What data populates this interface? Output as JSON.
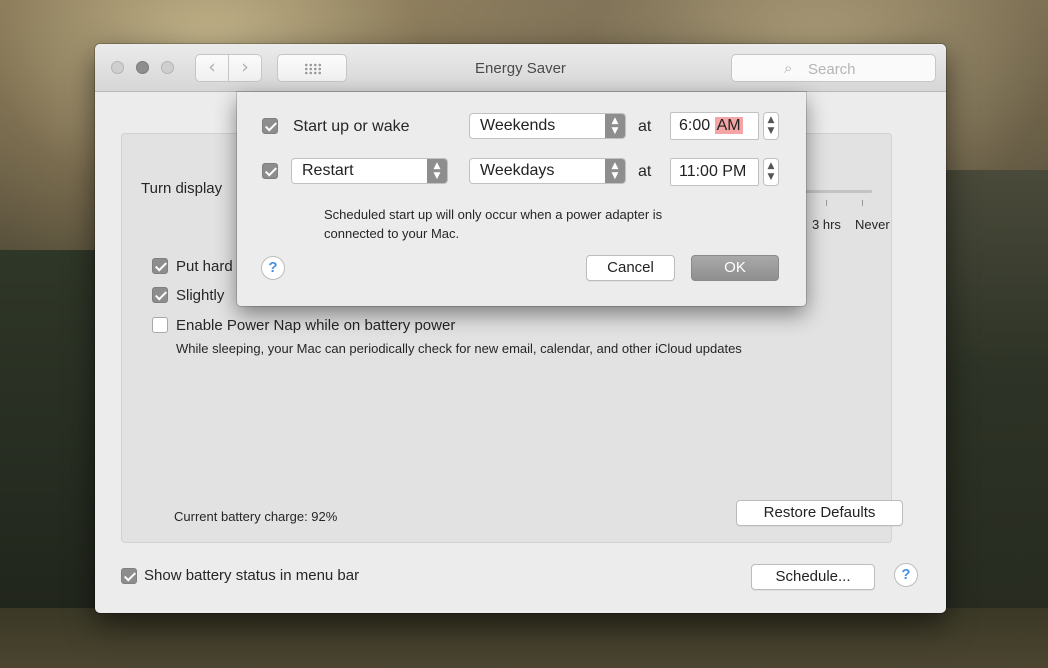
{
  "window": {
    "title": "Energy Saver",
    "search_placeholder": "Search",
    "nav": {
      "back_icon": "‹",
      "forward_icon": "›"
    }
  },
  "main": {
    "turn_display_label": "Turn display",
    "slider_ticks": [
      "3 hrs",
      "Never"
    ],
    "options": [
      {
        "label": "Put hard",
        "checked": true
      },
      {
        "label": "Slightly",
        "checked": true
      },
      {
        "label": "Enable Power Nap while on battery power",
        "checked": false
      }
    ],
    "power_nap_note": "While sleeping, your Mac can periodically check for new email, calendar, and other iCloud updates",
    "battery_charge_text": "Current battery charge: 92%",
    "restore_defaults_label": "Restore Defaults",
    "show_battery_label": "Show battery status in menu bar",
    "show_battery_checked": true,
    "schedule_button_label": "Schedule...",
    "help_label": "?"
  },
  "schedule_sheet": {
    "row1": {
      "checked": true,
      "action_label": "Start up or wake",
      "days": "Weekends",
      "at_label": "at",
      "time": "6:00",
      "ampm": "AM"
    },
    "row2": {
      "checked": true,
      "action": "Restart",
      "days": "Weekdays",
      "at_label": "at",
      "time": "11:00 PM"
    },
    "note_line1": "Scheduled start up will only occur when a power adapter is",
    "note_line2": "connected to your Mac.",
    "help_label": "?",
    "cancel_label": "Cancel",
    "ok_label": "OK"
  },
  "colors": {
    "accent_help": "#4a90e2",
    "ampm_highlight": "#f4a5a5",
    "checkbox_on": "#8d8d8d"
  }
}
